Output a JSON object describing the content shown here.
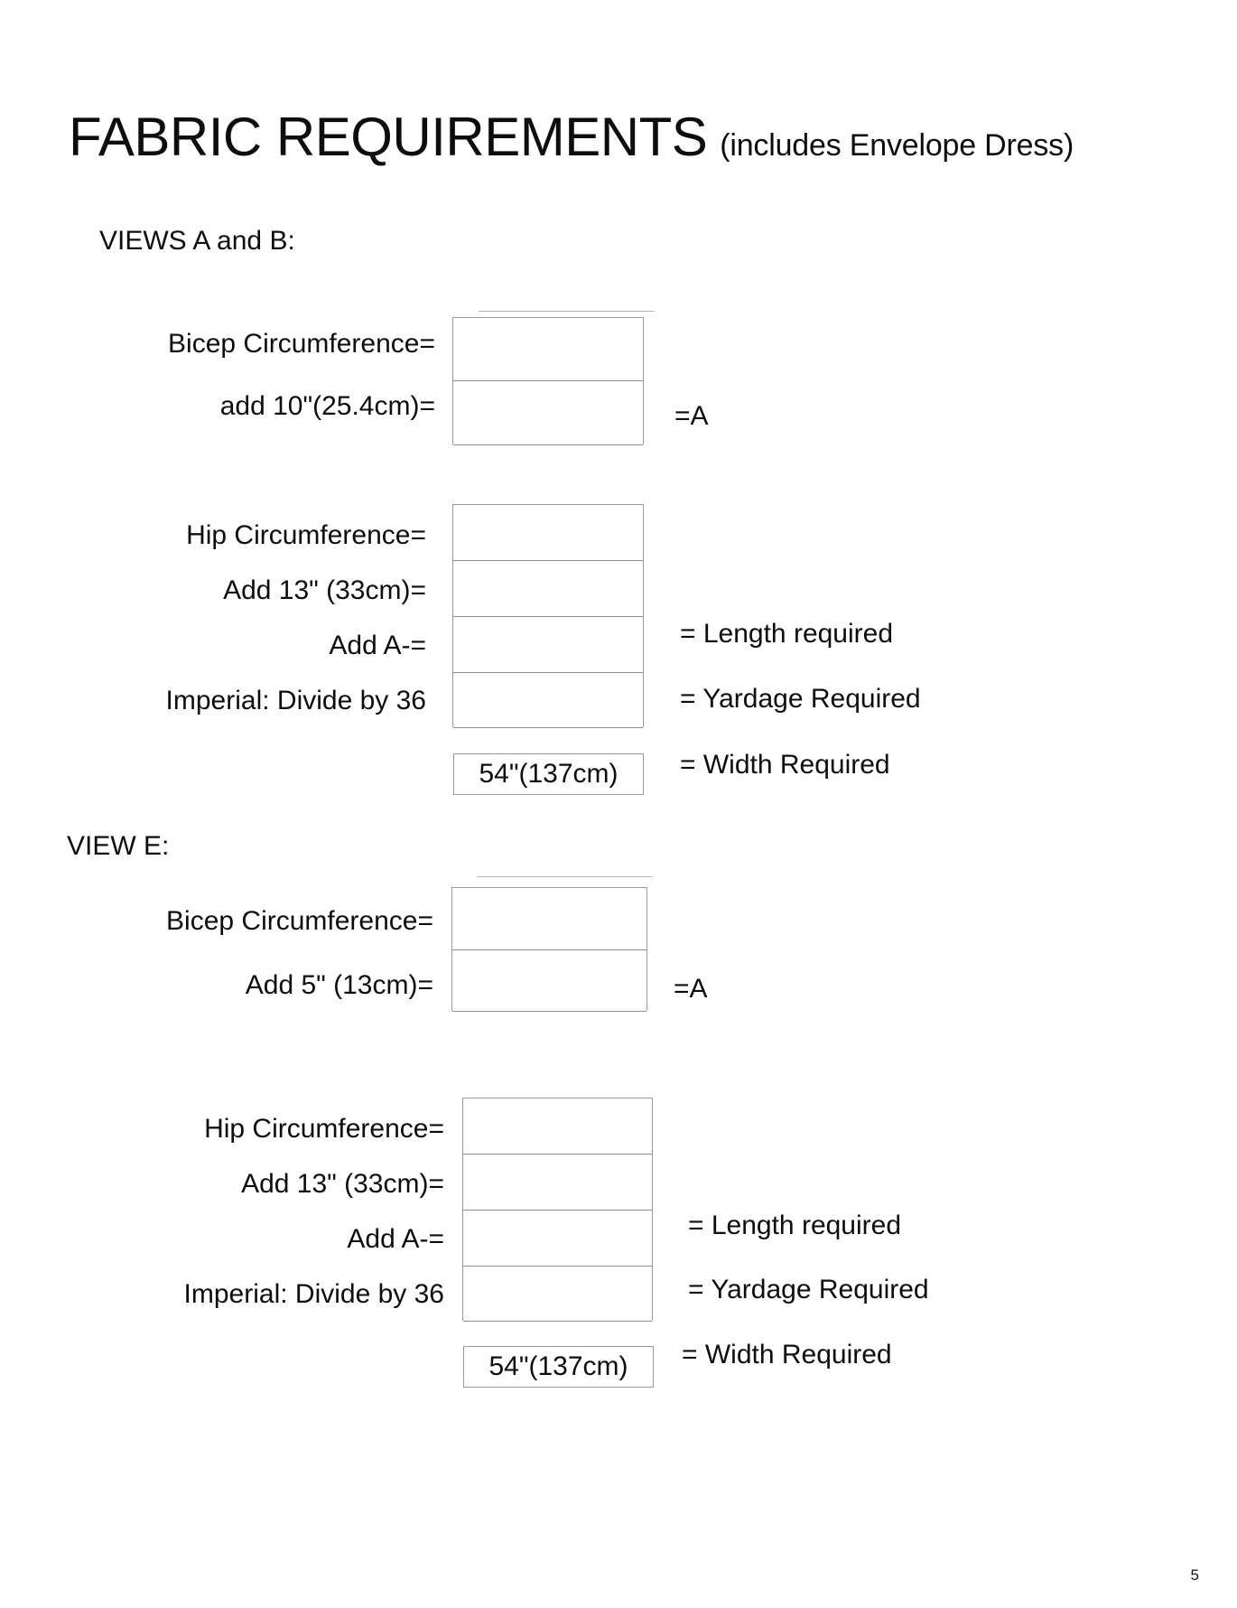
{
  "title": {
    "main": "FABRIC REQUIREMENTS",
    "sub": "(includes Envelope Dress)"
  },
  "sections": [
    {
      "heading": "VIEWS A and B:",
      "bicep": {
        "labels": [
          "Bicep Circumference=",
          "add 10\"(25.4cm)="
        ],
        "rows": 2,
        "result_note": "=A"
      },
      "hip": {
        "labels": [
          "Hip Circumference=",
          "Add 13\" (33cm)=",
          "Add A-=",
          "Imperial: Divide by 36"
        ],
        "rows": 4,
        "width_value": "54\"(137cm)",
        "notes": [
          "= Length required",
          "= Yardage Required",
          "= Width Required"
        ]
      }
    },
    {
      "heading": "VIEW E:",
      "bicep": {
        "labels": [
          "Bicep Circumference=",
          "Add 5\" (13cm)="
        ],
        "rows": 2,
        "result_note": "=A"
      },
      "hip": {
        "labels": [
          "Hip Circumference=",
          "Add 13\" (33cm)=",
          "Add A-=",
          "Imperial: Divide by 36"
        ],
        "rows": 4,
        "width_value": "54\"(137cm)",
        "notes": [
          "= Length required",
          "= Yardage Required",
          "= Width Required"
        ]
      }
    }
  ],
  "footer": {
    "page_number": "5"
  }
}
